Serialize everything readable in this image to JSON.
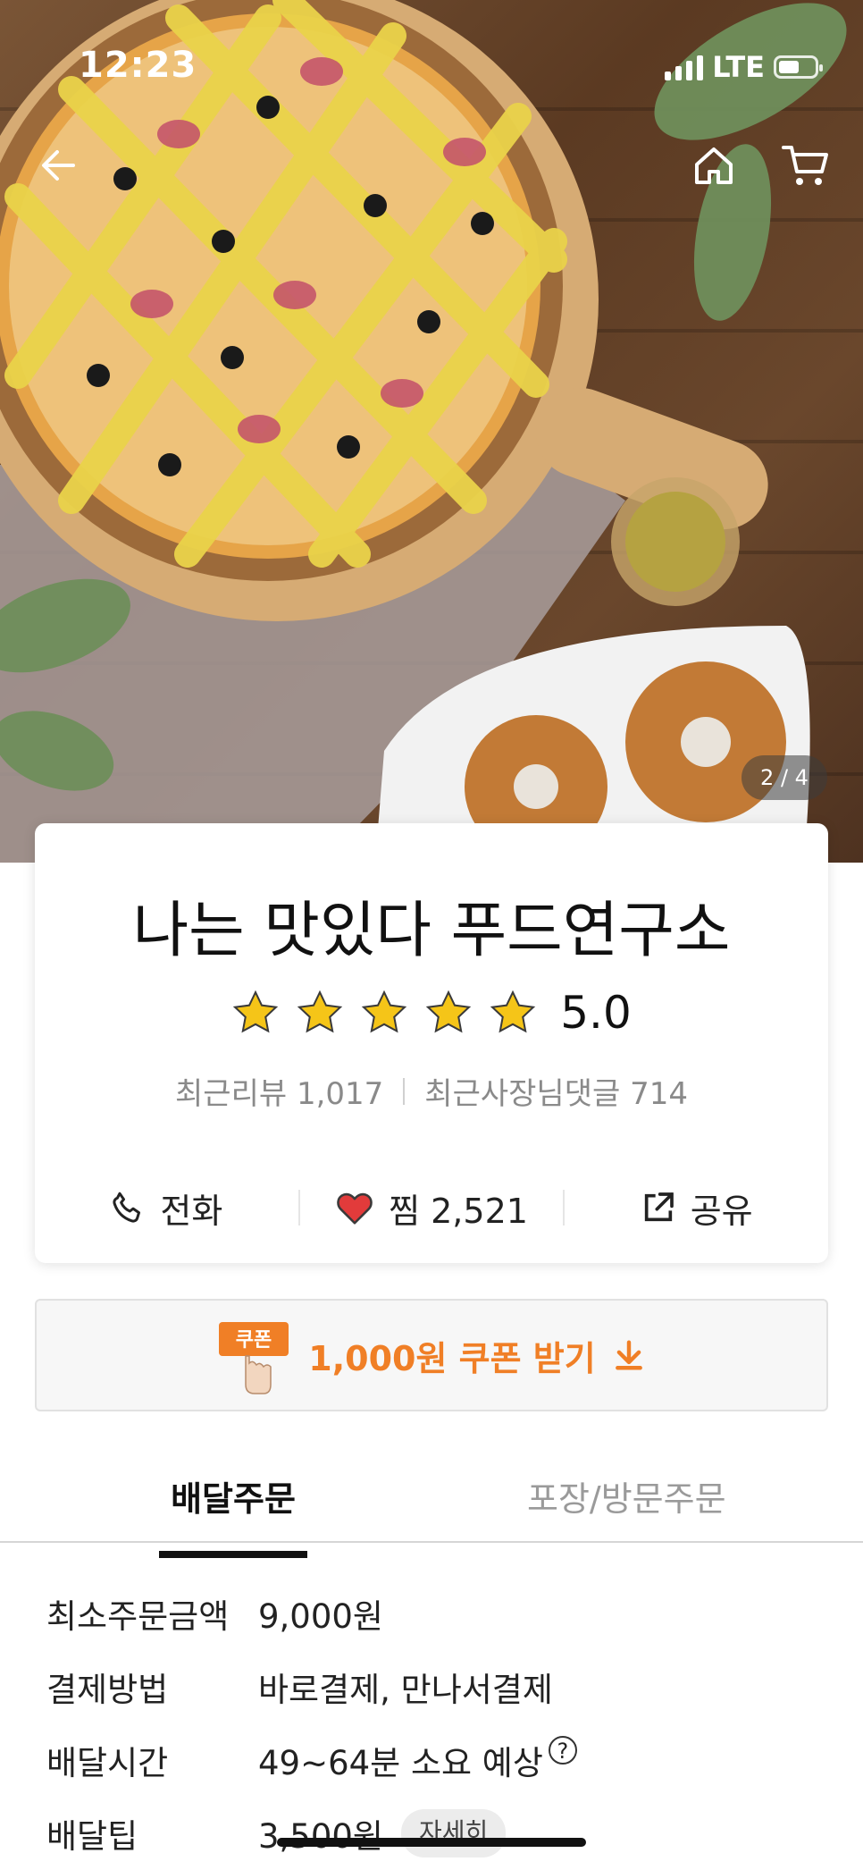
{
  "status": {
    "time": "12:23",
    "network": "LTE"
  },
  "hero": {
    "counter": "2 / 4"
  },
  "store": {
    "name": "나는 맛있다 푸드연구소",
    "rating": "5.0",
    "star_count": 5,
    "reviews": "최근리뷰 1,017",
    "owner_replies": "최근사장님댓글 714"
  },
  "actions": {
    "call": "전화",
    "like": "찜 2,521",
    "share": "공유"
  },
  "coupon": {
    "badge": "쿠폰",
    "label": "1,000원 쿠폰 받기"
  },
  "tabs": {
    "delivery": "배달주문",
    "pickup": "포장/방문주문"
  },
  "info": [
    {
      "label": "최소주문금액",
      "value": "9,000원"
    },
    {
      "label": "결제방법",
      "value": "바로결제, 만나서결제"
    },
    {
      "label": "배달시간",
      "value": "49~64분 소요 예상"
    },
    {
      "label": "배달팁",
      "value": "3,500원",
      "button": "자세히"
    }
  ],
  "colors": {
    "accent": "#f07f26",
    "star": "#f5c518",
    "heart": "#e23b3b"
  }
}
